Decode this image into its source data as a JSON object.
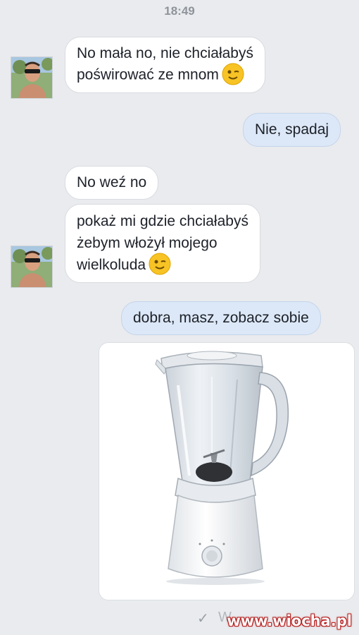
{
  "timestamp": "18:49",
  "messages": [
    {
      "lines": [
        "No mała no, nie chciałabyś",
        "poświrować ze mnom"
      ],
      "emoji": "wink-emoji"
    },
    {
      "lines": [
        "Nie, spadaj"
      ]
    },
    {
      "lines": [
        "No weź no"
      ]
    },
    {
      "lines": [
        "pokaż mi gdzie chciałabyś",
        "żebym włożył mojego",
        "wielkoluda"
      ],
      "emoji": "wink-emoji"
    },
    {
      "lines": [
        "dobra, masz, zobacz sobie"
      ]
    }
  ],
  "attachment": {
    "icon": "blender-image"
  },
  "footer": {
    "seen_prefix": "W"
  },
  "watermark": "www.wiocha.pl",
  "colors": {
    "background": "#e9ebee",
    "incoming_bubble": "#ffffff",
    "outgoing_bubble": "#dce8f7",
    "text": "#1d2129"
  }
}
